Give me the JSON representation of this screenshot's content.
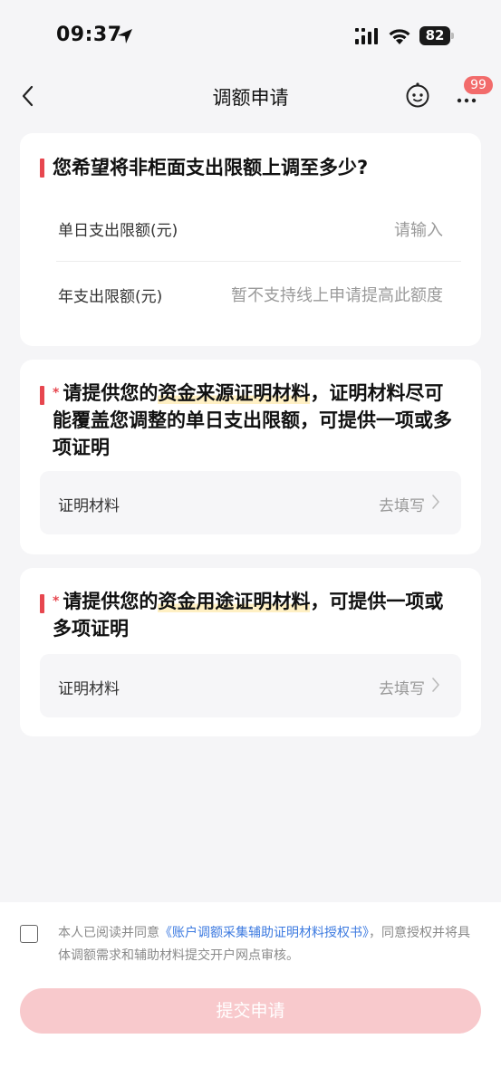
{
  "status_bar": {
    "time": "09:37",
    "battery": "82"
  },
  "nav": {
    "title": "调额申请",
    "badge": "99"
  },
  "card1": {
    "question": "您希望将非柜面支出限额上调至多少?",
    "daily_label": "单日支出限额(元)",
    "daily_placeholder": "请输入",
    "yearly_label": "年支出限额(元)",
    "yearly_value": "暂不支持线上申请提高此额度"
  },
  "card2": {
    "required_mark": "*",
    "q_part1": "请提供您的",
    "q_highlight": "资金来源证明材料",
    "q_part2": "，证明材料尽可能覆盖您调整的单日支出限额，可提供一项或多项证明",
    "item_label": "证明材料",
    "item_action": "去填写"
  },
  "card3": {
    "required_mark": "*",
    "q_part1": "请提供您的",
    "q_highlight": "资金用途证明材料",
    "q_part2": "，可提供一项或多项证明",
    "item_label": "证明材料",
    "item_action": "去填写"
  },
  "agreement": {
    "prefix": "本人已阅读并同意",
    "link": "《账户调额采集辅助证明材料授权书》",
    "suffix": "，同意授权并将具体调额需求和辅助材料提交开户网点审核。"
  },
  "submit_label": "提交申请",
  "colors": {
    "accent": "#e7474f",
    "link": "#3c7ae0",
    "button_disabled": "#f8c9cc",
    "highlight": "#fff0c4"
  }
}
